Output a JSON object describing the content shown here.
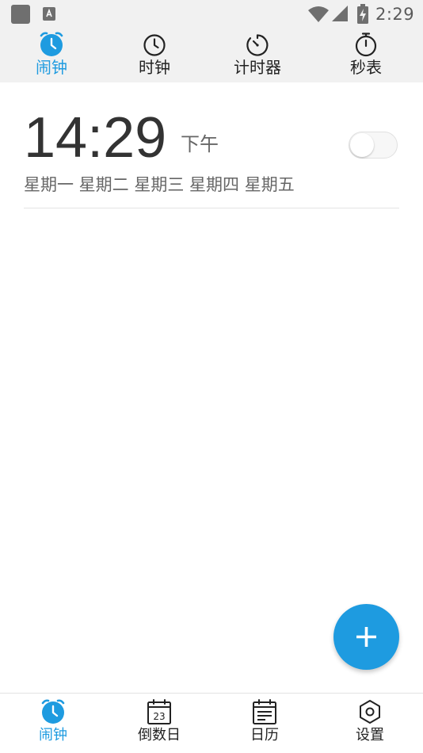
{
  "status_bar": {
    "time": "2:29",
    "app_icon": "gallery-square-icon",
    "keyboard_icon": "input-method-a-icon",
    "wifi_icon": "wifi-icon",
    "signal_icon": "cell-signal-icon",
    "battery_icon": "battery-charging-icon"
  },
  "top_tabs": [
    {
      "label": "闹钟",
      "icon": "alarm-clock-icon",
      "active": true
    },
    {
      "label": "时钟",
      "icon": "clock-icon",
      "active": false
    },
    {
      "label": "计时器",
      "icon": "timer-icon",
      "active": false
    },
    {
      "label": "秒表",
      "icon": "stopwatch-icon",
      "active": false
    }
  ],
  "alarm": {
    "time": "14:29",
    "ampm": "下午",
    "days": "星期一 星期二 星期三 星期四 星期五",
    "enabled": false
  },
  "fab": {
    "icon": "plus-icon"
  },
  "bottom_nav": [
    {
      "label": "闹钟",
      "icon": "alarm-clock-icon",
      "active": true
    },
    {
      "label": "倒数日",
      "icon": "calendar-countdown-icon",
      "calendar_day": "23",
      "active": false
    },
    {
      "label": "日历",
      "icon": "calendar-list-icon",
      "active": false
    },
    {
      "label": "设置",
      "icon": "settings-hexagon-icon",
      "active": false
    }
  ],
  "colors": {
    "accent": "#1e9be0",
    "header_bg": "#f1f1f1",
    "text_primary": "#333333",
    "text_secondary": "#666666",
    "divider": "#e3e3e3"
  }
}
